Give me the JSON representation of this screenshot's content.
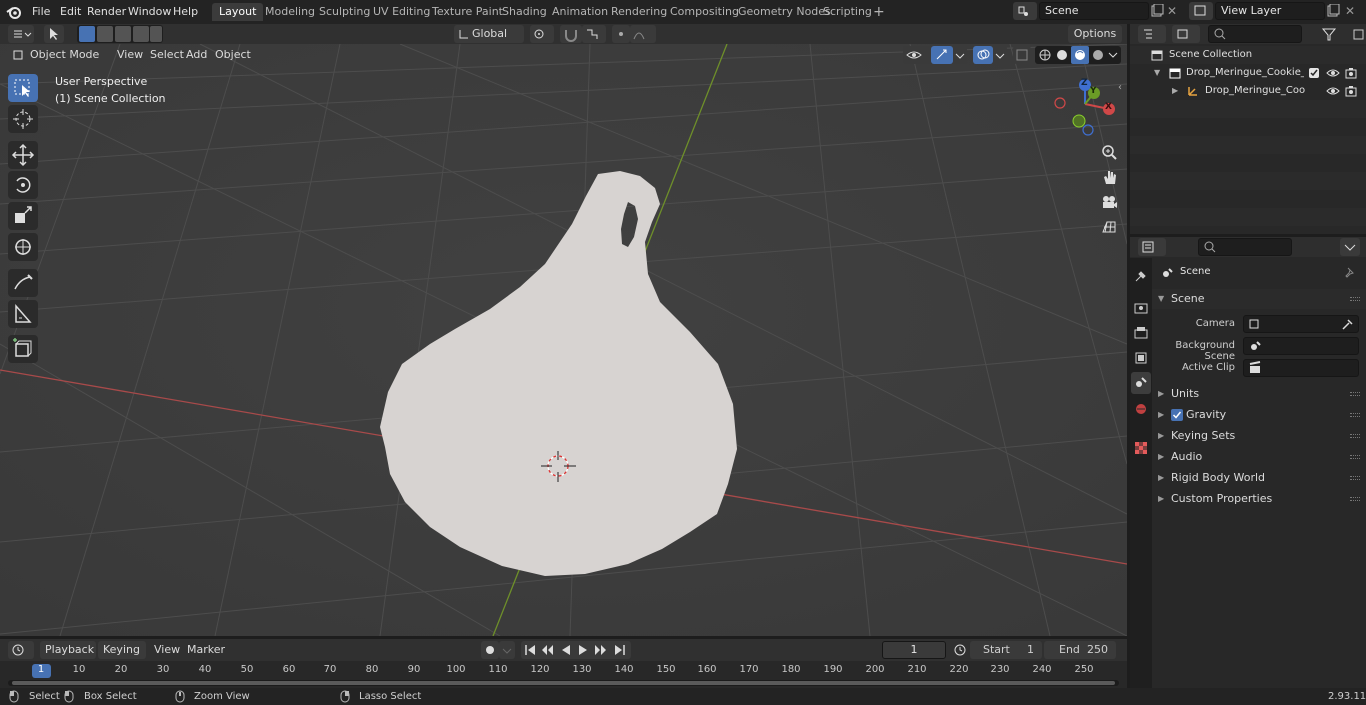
{
  "app": {
    "name": "Blender",
    "version": "2.93.11"
  },
  "menu": [
    "File",
    "Edit",
    "Render",
    "Window",
    "Help"
  ],
  "workspaces": [
    {
      "label": "Layout",
      "active": true
    },
    {
      "label": "Modeling"
    },
    {
      "label": "Sculpting"
    },
    {
      "label": "UV Editing"
    },
    {
      "label": "Texture Paint"
    },
    {
      "label": "Shading"
    },
    {
      "label": "Animation"
    },
    {
      "label": "Rendering"
    },
    {
      "label": "Compositing"
    },
    {
      "label": "Geometry Nodes"
    },
    {
      "label": "Scripting"
    }
  ],
  "add_workspace": "+",
  "scene_field": "Scene",
  "view_layer_field": "View Layer",
  "viewport": {
    "mode": "Object Mode",
    "menus": [
      "View",
      "Select",
      "Add",
      "Object"
    ],
    "orientation": "Global",
    "options_label": "Options",
    "perspective_label": "User Perspective",
    "collection_label": "(1) Scene Collection",
    "gizmo_axes": {
      "x": "X",
      "y": "Y",
      "z": "Z"
    }
  },
  "outliner": {
    "root": "Scene Collection",
    "collection": "Drop_Meringue_Cookie_Cara",
    "object": "Drop_Meringue_Cookie_("
  },
  "properties": {
    "header": "Scene",
    "panel": "Scene",
    "fields": [
      {
        "label": "Camera"
      },
      {
        "label": "Background Scene"
      },
      {
        "label": "Active Clip"
      }
    ],
    "subpanels": [
      "Units",
      "Gravity",
      "Keying Sets",
      "Audio",
      "Rigid Body World",
      "Custom Properties"
    ],
    "gravity_checked": true
  },
  "timeline": {
    "menus": [
      "Playback",
      "Keying",
      "View",
      "Marker"
    ],
    "current_frame": "1",
    "start_label": "Start",
    "start_value": "1",
    "end_label": "End",
    "end_value": "250",
    "ticks": [
      "1",
      "10",
      "20",
      "30",
      "40",
      "50",
      "60",
      "70",
      "80",
      "90",
      "100",
      "110",
      "120",
      "130",
      "140",
      "150",
      "160",
      "170",
      "180",
      "190",
      "200",
      "210",
      "220",
      "230",
      "240",
      "250"
    ]
  },
  "statusbar": {
    "select": "Select",
    "box_select": "Box Select",
    "zoom_view": "Zoom View",
    "lasso_select": "Lasso Select",
    "version": "2.93.11"
  },
  "colors": {
    "accent": "#4772b3",
    "axis_x": "#b34545",
    "axis_y": "#7a9a2a",
    "mesh": "#d9d5d3",
    "viewport_bg": "#3d3d3d"
  }
}
